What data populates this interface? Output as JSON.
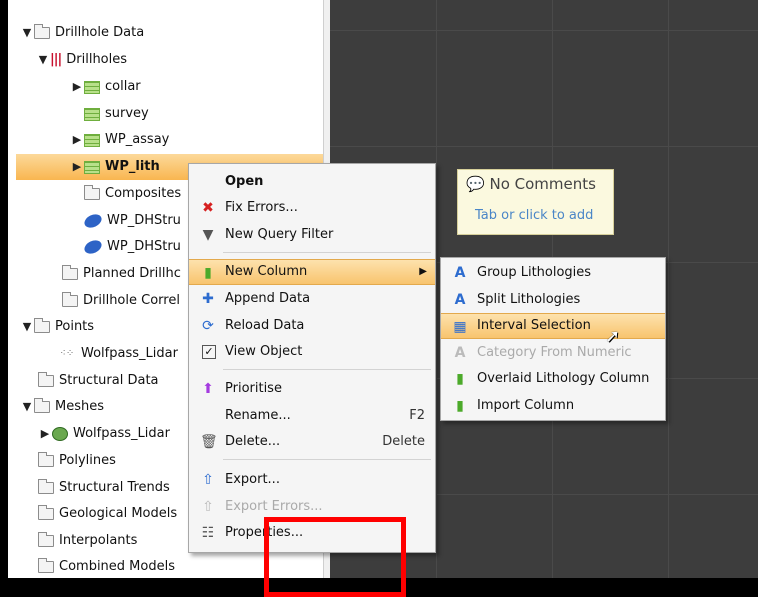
{
  "tree": {
    "items": [
      {
        "label": "Drillhole Data"
      },
      {
        "label": "Drillholes"
      },
      {
        "label": "collar"
      },
      {
        "label": "survey"
      },
      {
        "label": "WP_assay"
      },
      {
        "label": "WP_lith"
      },
      {
        "label": "Composites"
      },
      {
        "label": "WP_DHStru"
      },
      {
        "label": "WP_DHStru"
      },
      {
        "label": "Planned Drillhc"
      },
      {
        "label": "Drillhole Correl"
      },
      {
        "label": "Points"
      },
      {
        "label": "Wolfpass_Lidar"
      },
      {
        "label": "Structural Data"
      },
      {
        "label": "Meshes"
      },
      {
        "label": "Wolfpass_Lidar"
      },
      {
        "label": "Polylines"
      },
      {
        "label": "Structural Trends"
      },
      {
        "label": "Geological Models"
      },
      {
        "label": "Interpolants"
      },
      {
        "label": "Combined Models"
      }
    ]
  },
  "menu": {
    "open": "Open",
    "fix_errors": "Fix Errors...",
    "new_query_filter": "New Query Filter",
    "new_column": "New Column",
    "append_data": "Append Data",
    "reload_data": "Reload Data",
    "view_object": "View Object",
    "prioritise": "Prioritise",
    "rename": "Rename...",
    "rename_shortcut": "F2",
    "delete": "Delete...",
    "delete_shortcut": "Delete",
    "export": "Export...",
    "export_errors": "Export Errors...",
    "properties": "Properties..."
  },
  "submenu": {
    "group_lithologies": "Group Lithologies",
    "split_lithologies": "Split Lithologies",
    "interval_selection": "Interval Selection",
    "category_from_numeric": "Category From Numeric",
    "overlaid_lithology_column": "Overlaid Lithology Column",
    "import_column": "Import Column"
  },
  "comments": {
    "title": "No Comments",
    "hint": "Tab or click to add"
  },
  "colors": {
    "highlight": "#f9c26a",
    "viewport": "#3d3d3d",
    "annotation": "#ff0000"
  }
}
